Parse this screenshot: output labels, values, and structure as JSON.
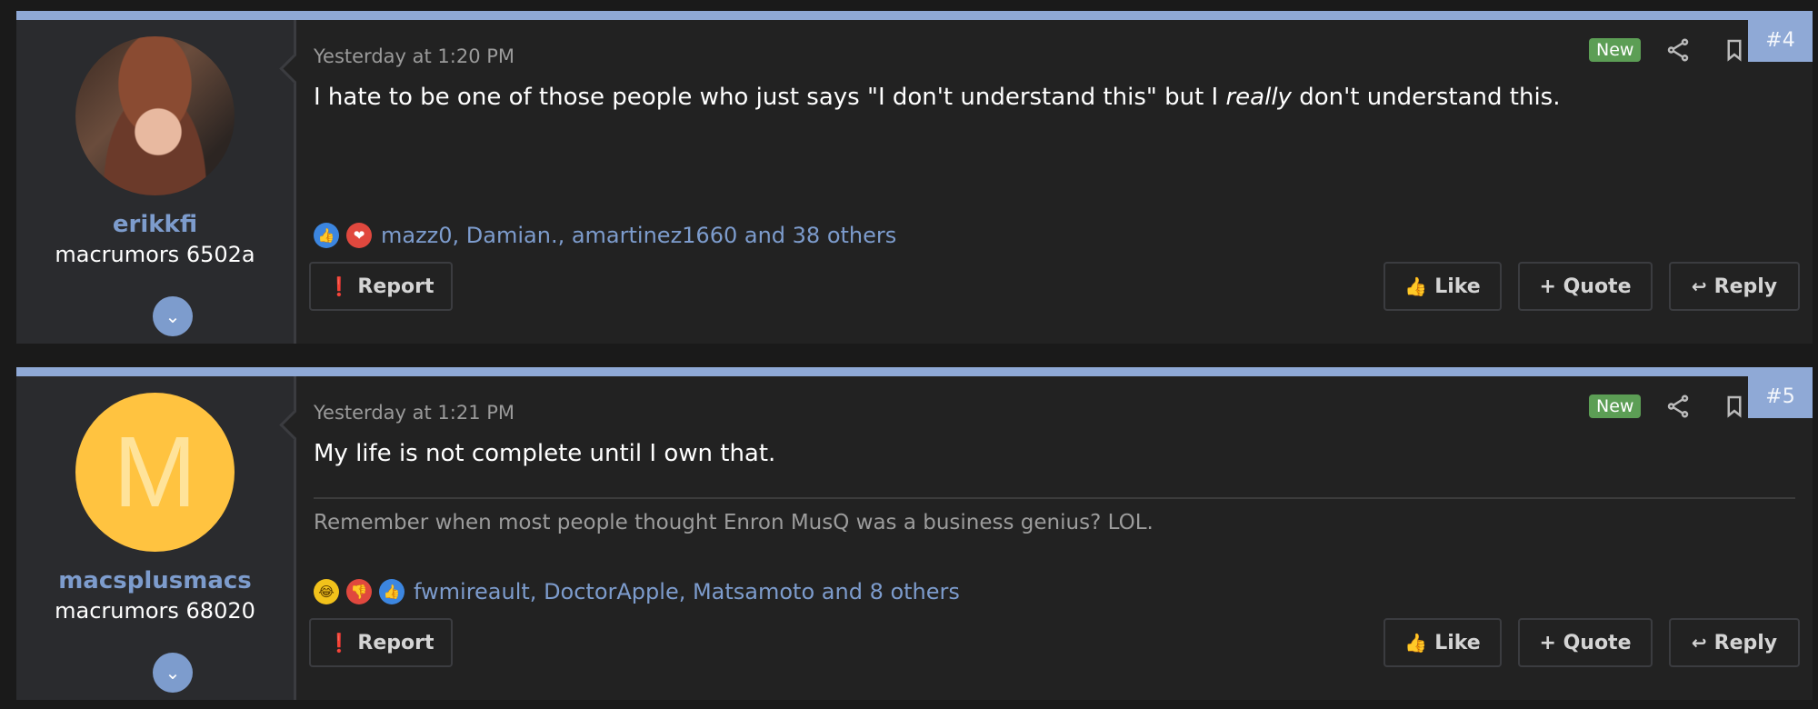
{
  "posts": [
    {
      "user": {
        "name": "erikkfi",
        "title": "macrumors 6502a"
      },
      "date": "Yesterday at 1:20 PM",
      "badge": "New",
      "number": "#4",
      "body_pre": "I hate to be one of those people who just says \"I don't understand this\" but I ",
      "body_em": "really",
      "body_post": " don't understand this.",
      "reaction_icons": [
        "like",
        "love"
      ],
      "reactions": "mazz0, Damian., amartinez1660 and 38 others"
    },
    {
      "user": {
        "name": "macsplusmacs",
        "title": "macrumors 68020",
        "avatar_letter": "M",
        "avatar_color": "#ffc340"
      },
      "date": "Yesterday at 1:21 PM",
      "badge": "New",
      "number": "#5",
      "body": "My life is not complete until I own that.",
      "signature": "Remember when most people thought Enron MusQ was a business genius? LOL.",
      "reaction_icons": [
        "haha",
        "dislike",
        "like"
      ],
      "reactions": "fwmireault, DoctorApple, Matsamoto and 8 others"
    }
  ],
  "actions": {
    "report": "Report",
    "like": "Like",
    "quote": "+ Quote",
    "reply": "Reply"
  },
  "colors": {
    "accent": "#8fa9d6",
    "username": "#7d9ccd",
    "new_badge": "#5c9e55",
    "background": "#222222"
  },
  "icons": [
    "share-icon",
    "bookmark-icon",
    "chevron-down-icon",
    "report-icon",
    "thumbs-up-icon",
    "reply-icon"
  ]
}
